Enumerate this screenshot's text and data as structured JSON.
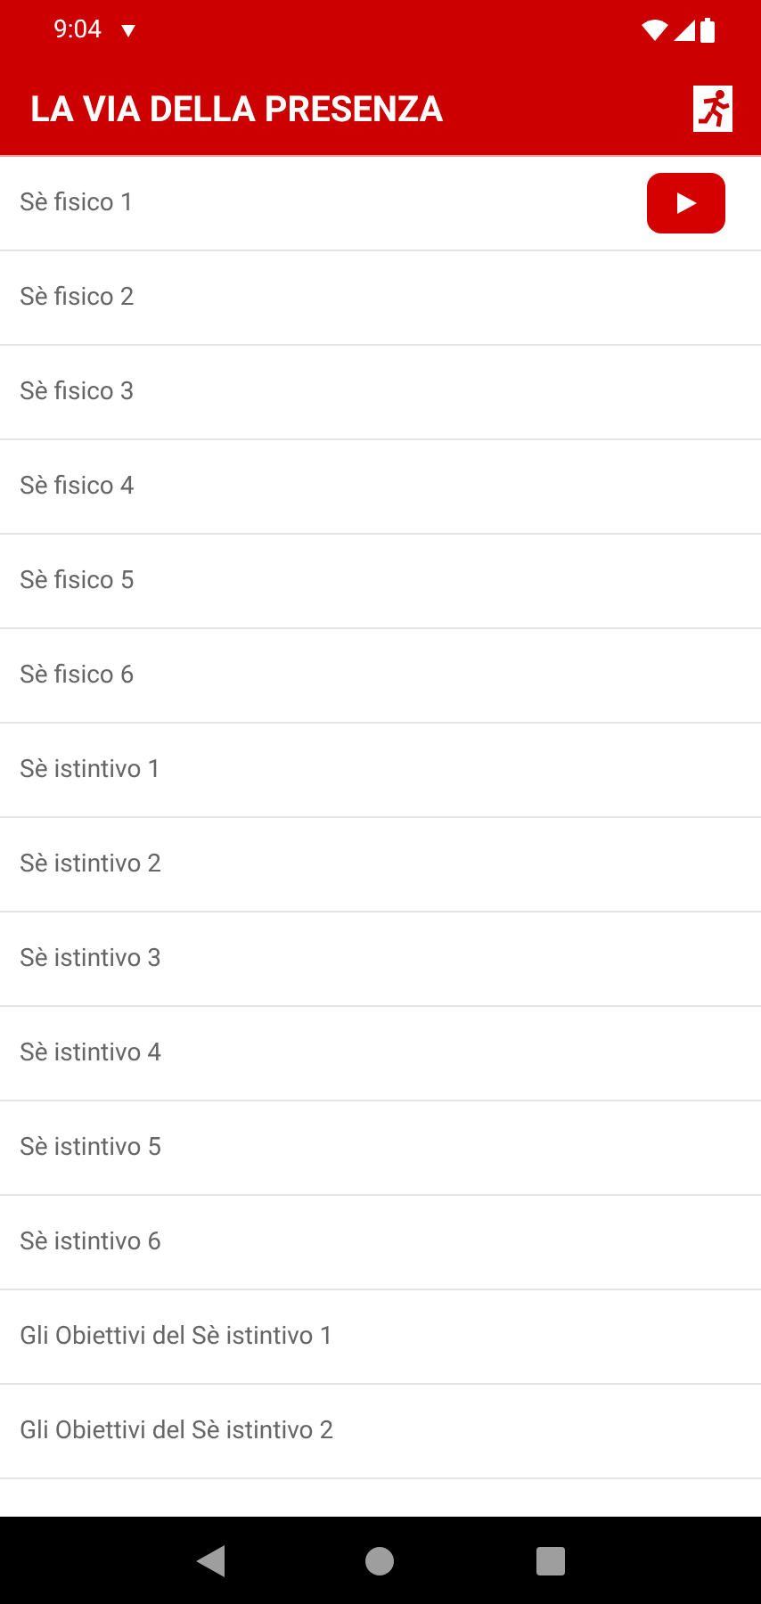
{
  "status_bar": {
    "time": "9:04"
  },
  "app_bar": {
    "title": "LA VIA DELLA PRESENZA"
  },
  "items": [
    {
      "label": "Sè fisico 1",
      "video": true
    },
    {
      "label": "Sè fisico 2",
      "video": false
    },
    {
      "label": "Sè fisico 3",
      "video": false
    },
    {
      "label": "Sè fisico 4",
      "video": false
    },
    {
      "label": "Sè fisico 5",
      "video": false
    },
    {
      "label": "Sè fisico 6",
      "video": false
    },
    {
      "label": "Sè istintivo 1",
      "video": false
    },
    {
      "label": "Sè istintivo 2",
      "video": false
    },
    {
      "label": "Sè istintivo 3",
      "video": false
    },
    {
      "label": "Sè istintivo 4",
      "video": false
    },
    {
      "label": "Sè istintivo 5",
      "video": false
    },
    {
      "label": "Sè istintivo 6",
      "video": false
    },
    {
      "label": "Gli Obiettivi del Sè istintivo 1",
      "video": false
    },
    {
      "label": "Gli Obiettivi del Sè istintivo 2",
      "video": false
    }
  ]
}
